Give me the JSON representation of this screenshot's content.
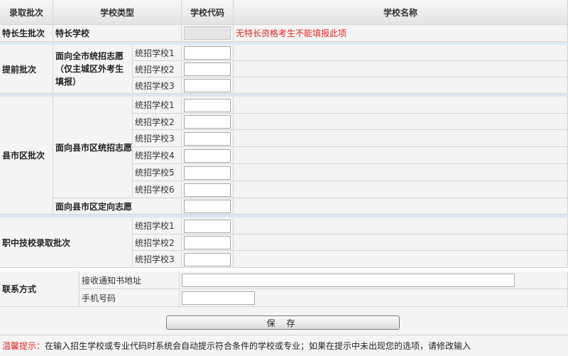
{
  "header": {
    "col_batch": "录取批次",
    "col_type": "学校类型",
    "col_code": "学校代码",
    "col_name": "学校名称"
  },
  "special": {
    "batch": "特长生批次",
    "type": "特长学校",
    "warning": "无特长资格考生不能填报此项"
  },
  "early": {
    "batch": "提前批次",
    "type": "面向全市统招志愿（仅主城区外考生填报）",
    "items": [
      "统招学校1",
      "统招学校2",
      "统招学校3"
    ]
  },
  "county": {
    "batch": "县市区批次",
    "type_general": "面向县市区统招志愿",
    "items": [
      "统招学校1",
      "统招学校2",
      "统招学校3",
      "统招学校4",
      "统招学校5",
      "统招学校6"
    ],
    "type_directed": "面向县市区定向志愿"
  },
  "vocational": {
    "batch": "职中技校录取批次",
    "items": [
      "统招学校1",
      "统招学校2",
      "统招学校3"
    ]
  },
  "contact": {
    "label": "联系方式",
    "address_label": "接收通知书地址",
    "phone_label": "手机号码"
  },
  "save_label": "保 存",
  "tip": {
    "title": "温馨提示：",
    "text": "在输入招生学校或专业代码时系统会自动提示符合条件的学校或专业；如果在提示中未出现您的选项，请修改输入"
  }
}
